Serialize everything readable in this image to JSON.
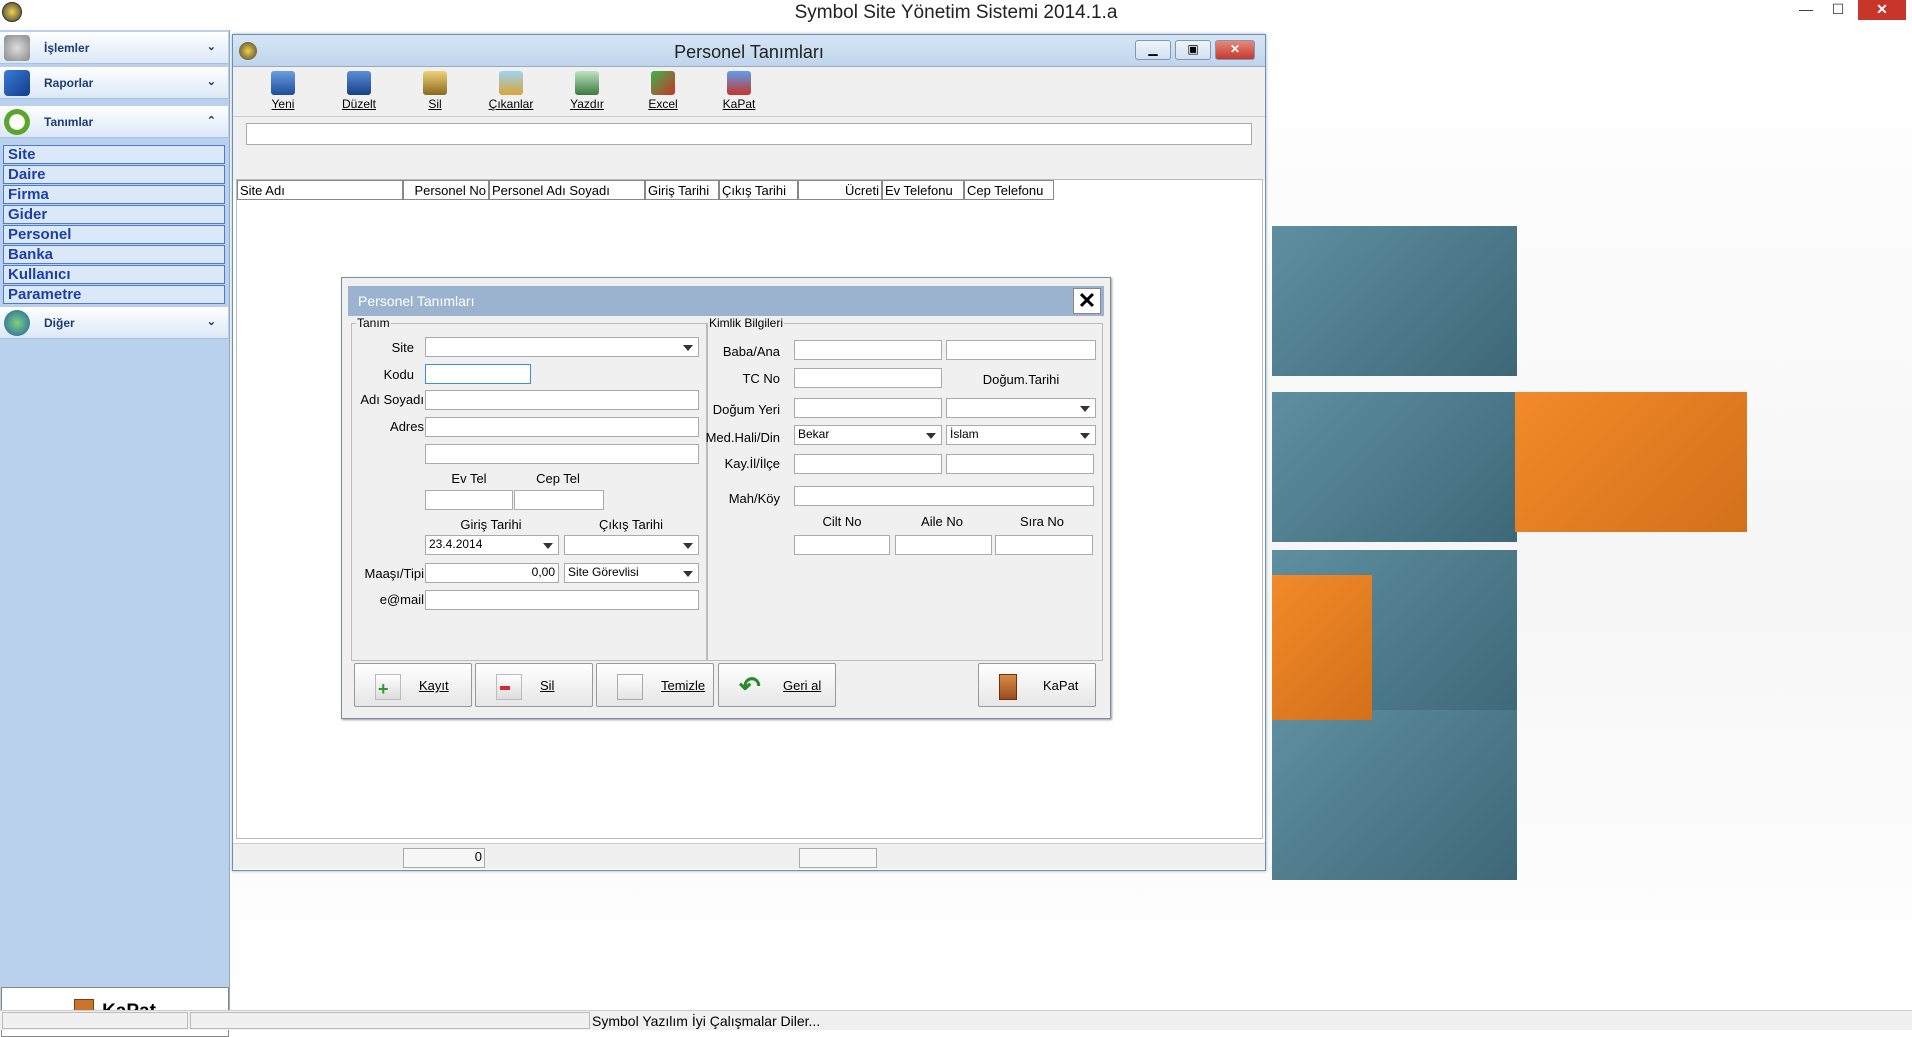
{
  "app": {
    "title": "Symbol Site Yönetim Sistemi 2014.1.a"
  },
  "window_controls": {
    "minimize": "—",
    "maximize": "☐",
    "close": "✕"
  },
  "sidebar": {
    "sections": [
      {
        "label": "İşlemler",
        "icon": "gear-icon"
      },
      {
        "label": "Raporlar",
        "icon": "book-icon"
      },
      {
        "label": "Tanımlar",
        "icon": "clock-icon"
      }
    ],
    "items": [
      "Site",
      "Daire",
      "Firma",
      "Gider",
      "Personel",
      "Banka",
      "Kullanıcı",
      "Parametre"
    ],
    "other": {
      "label": "Diğer",
      "icon": "globe-icon"
    },
    "exit_label": "KaPat"
  },
  "mdi": {
    "title": "Personel Tanımları",
    "toolbar": [
      {
        "label": "Yeni",
        "icon": "new-icon"
      },
      {
        "label": "Düzelt",
        "icon": "edit-icon"
      },
      {
        "label": "Sil",
        "icon": "delete-icon"
      },
      {
        "label": "Çıkanlar",
        "icon": "leavers-icon"
      },
      {
        "label": "Yazdır",
        "icon": "print-icon"
      },
      {
        "label": "Excel",
        "icon": "excel-icon"
      },
      {
        "label": "KaPat",
        "icon": "exit-icon"
      }
    ],
    "grid_headers": [
      "Site Adı",
      "Personel No",
      "Personel Adı Soyadı",
      "Giriş Tarihi",
      "Çıkış Tarihi",
      "Ücreti",
      "Ev Telefonu",
      "Cep Telefonu"
    ],
    "footer_count": "0"
  },
  "dialog": {
    "title": "Personel Tanımları",
    "close": "✕",
    "group_tanim": "Tanım",
    "group_kimlik": "Kimlik Bilgileri",
    "labels": {
      "site": "Site",
      "kodu": "Kodu",
      "adi_soyadi": "Adı Soyadı",
      "adres": "Adres",
      "ev_tel": "Ev Tel",
      "cep_tel": "Cep Tel",
      "giris_tarihi": "Giriş Tarihi",
      "cikis_tarihi": "Çıkış Tarihi",
      "maas_tipi": "Maaşı/Tipi",
      "email": "e@mail",
      "baba_ana": "Baba/Ana",
      "tc_no": "TC No",
      "dogum_tarihi": "Doğum.Tarihi",
      "dogum_yeri": "Doğum Yeri",
      "med_hali_din": "Med.Hali/Din",
      "kay_il_ilce": "Kay.İl/İlçe",
      "mah_koy": "Mah/Köy",
      "cilt_no": "Cilt No",
      "aile_no": "Aile No",
      "sira_no": "Sıra No"
    },
    "values": {
      "giris_tarihi": "23.4.2014",
      "maas": "0,00",
      "tipi": "Site Görevlisi",
      "medeni_hal": "Bekar",
      "din": "İslam"
    },
    "buttons": {
      "kayit": "Kayıt",
      "sil": "Sil",
      "temizle": "Temizle",
      "geri_al": "Geri al",
      "kapat": "KaPat"
    }
  },
  "status": {
    "text": "Symbol Yazılım İyi Çalışmalar Diler..."
  }
}
